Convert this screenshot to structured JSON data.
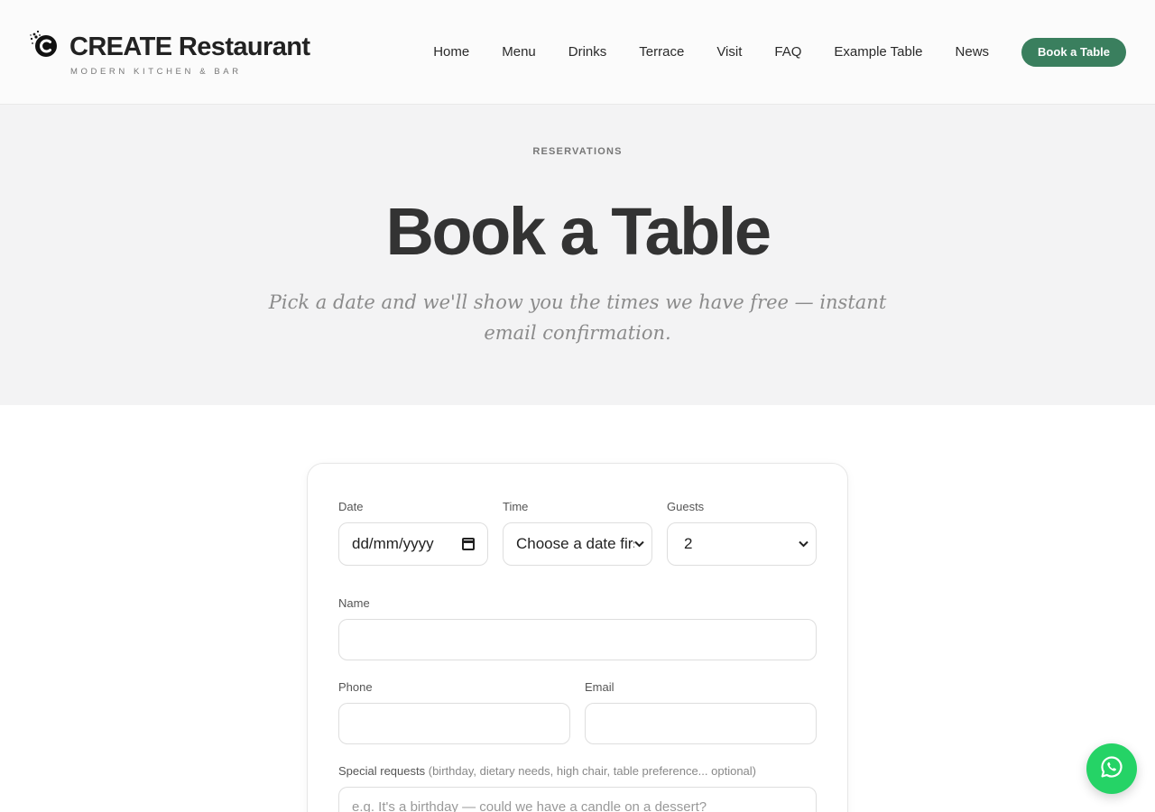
{
  "brand": {
    "name": "CREATE Restaurant",
    "tagline": "MODERN KITCHEN & BAR",
    "logo_icon": "c-logo-icon"
  },
  "nav": {
    "items": [
      "Home",
      "Menu",
      "Drinks",
      "Terrace",
      "Visit",
      "FAQ",
      "Example Table",
      "News"
    ],
    "cta": "Book a Table"
  },
  "hero": {
    "eyebrow": "RESERVATIONS",
    "title": "Book a Table",
    "subtitle": "Pick a date and we'll show you the times we have free — instant email confirmation."
  },
  "form": {
    "date": {
      "label": "Date",
      "placeholder": "dd/mm/yyyy",
      "icon": "calendar-icon"
    },
    "time": {
      "label": "Time",
      "value": "Choose a date firs"
    },
    "guests": {
      "label": "Guests",
      "value": "2"
    },
    "name": {
      "label": "Name",
      "value": ""
    },
    "phone": {
      "label": "Phone",
      "value": ""
    },
    "email": {
      "label": "Email",
      "value": ""
    },
    "requests": {
      "label": "Special requests",
      "hint": "(birthday, dietary needs, high chair, table preference... optional)",
      "placeholder": "e.g. It's a birthday — could we have a candle on a dessert?"
    }
  },
  "whatsapp": {
    "icon": "whatsapp-icon"
  },
  "colors": {
    "accent": "#3a7f5e",
    "whatsapp": "#25d366",
    "hero_bg": "#f3f3f4"
  }
}
